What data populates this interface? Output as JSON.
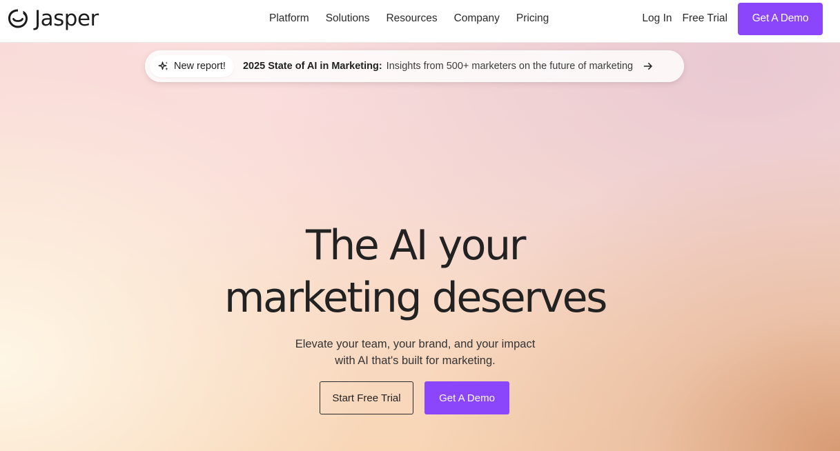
{
  "brand": {
    "name": "Jasper",
    "logo_icon": "jasper-face-icon",
    "accent_color": "#8b45fb"
  },
  "nav": {
    "items": [
      {
        "label": "Platform"
      },
      {
        "label": "Solutions"
      },
      {
        "label": "Resources"
      },
      {
        "label": "Company"
      },
      {
        "label": "Pricing"
      }
    ]
  },
  "header_actions": {
    "login_label": "Log In",
    "free_trial_label": "Free Trial",
    "demo_label": "Get A Demo"
  },
  "announcement": {
    "badge_icon": "sparkle-icon",
    "badge_label": "New report!",
    "title": "2025 State of AI in Marketing:",
    "description": "Insights from 500+ marketers on the future of marketing",
    "arrow_icon": "arrow-right-icon"
  },
  "hero": {
    "headline_line1": "The AI your",
    "headline_line2": "marketing deserves",
    "subtext_line1": "Elevate your team, your brand, and your impact",
    "subtext_line2": "with AI that's built for marketing.",
    "cta_secondary": "Start Free Trial",
    "cta_primary": "Get A Demo"
  }
}
